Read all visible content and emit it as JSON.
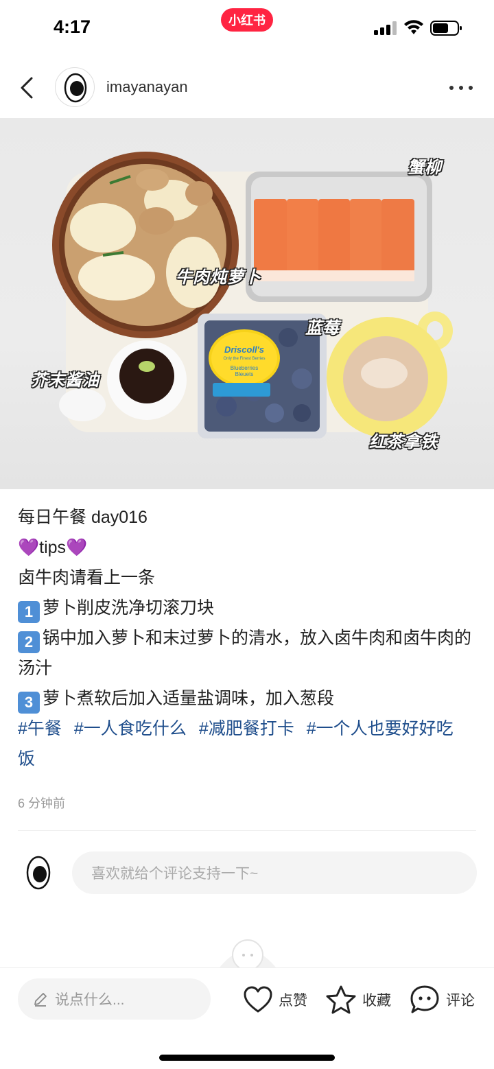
{
  "status_bar": {
    "time": "4:17",
    "app_badge": "小红书"
  },
  "header": {
    "username": "imayanayan"
  },
  "photo": {
    "labels": {
      "crab": "蟹柳",
      "beef": "牛肉炖萝卜",
      "blueberry": "蓝莓",
      "sauce": "芥末酱油",
      "latte": "红茶拿铁"
    },
    "brand": "Driscoll's",
    "brand_sub": "Only the Finest Berries",
    "pack_label": "Blueberries Bleuets"
  },
  "post": {
    "title": "每日午餐 day016",
    "tips_heart_left": "💜",
    "tips": "tips",
    "tips_heart_right": "💜",
    "intro": "卤牛肉请看上一条",
    "steps": [
      {
        "num": "1",
        "text": "萝卜削皮洗净切滚刀块"
      },
      {
        "num": "2",
        "text": "锅中加入萝卜和末过萝卜的清水，放入卤牛肉和卤牛肉的汤汁"
      },
      {
        "num": "3",
        "text": "萝卜煮软后加入适量盐调味，加入葱段"
      }
    ],
    "tags": [
      "#午餐",
      "#一人食吃什么",
      "#减肥餐打卡",
      "#一个人也要好好吃饭"
    ],
    "timestamp": "6 分钟前"
  },
  "comment": {
    "placeholder": "喜欢就给个评论支持一下~"
  },
  "bottom_bar": {
    "say_placeholder": "说点什么...",
    "like_label": "点赞",
    "collect_label": "收藏",
    "comment_label": "评论"
  },
  "colors": {
    "brand_red": "#ff2442",
    "tag_blue": "#1f4e8c",
    "step_badge": "#4f8fd6"
  }
}
